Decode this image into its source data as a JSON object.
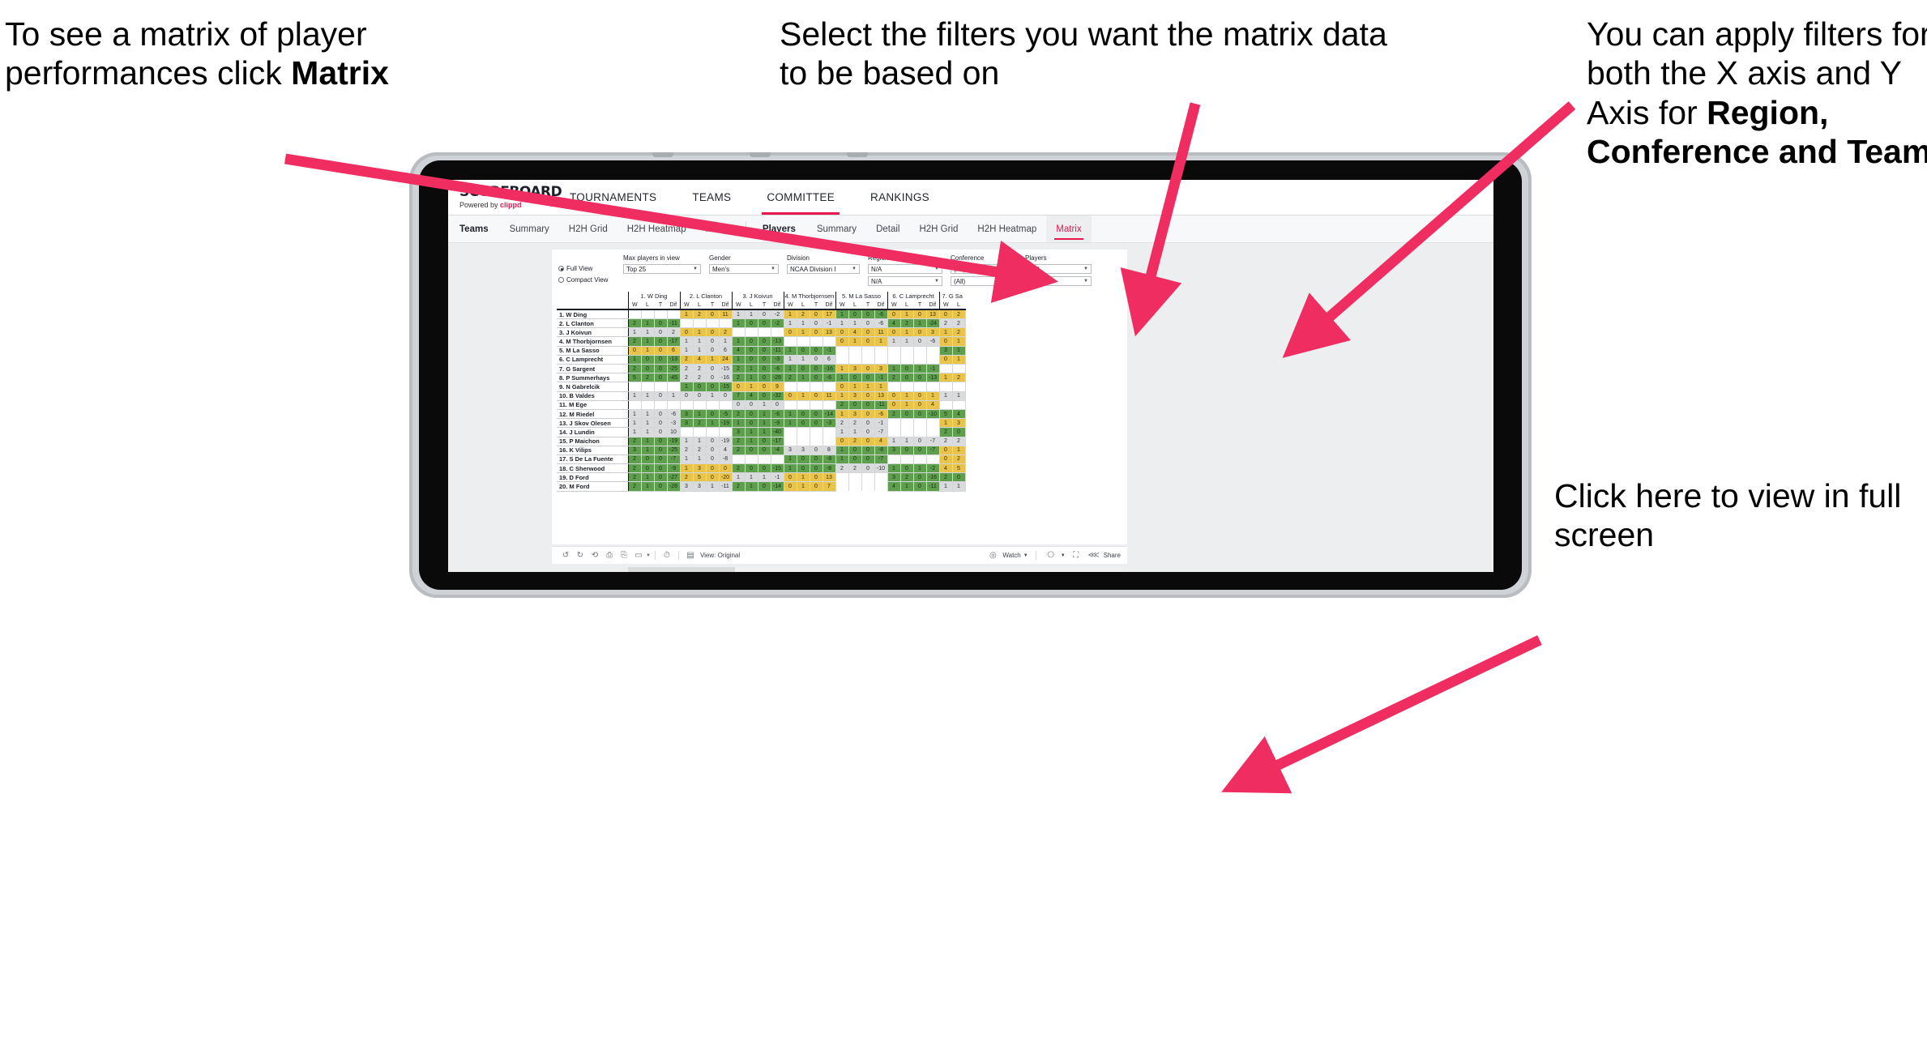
{
  "annotations": {
    "left": {
      "text_before": "To see a matrix of player performances click ",
      "bold": "Matrix"
    },
    "middle": {
      "text": "Select the filters you want the matrix data to be based on"
    },
    "right": {
      "text_before": "You  can apply filters for both the X axis and Y Axis for ",
      "bold": "Region, Conference and Team"
    },
    "fullscreen": {
      "text": "Click here to view in full screen"
    }
  },
  "brand": {
    "name": "SCOREBOARD",
    "powered_prefix": "Powered by ",
    "powered_brand": "clippd",
    "accent": "#e8174e"
  },
  "topnav": {
    "items": [
      "TOURNAMENTS",
      "TEAMS",
      "COMMITTEE",
      "RANKINGS"
    ],
    "active": "TEAMS"
  },
  "subnav": {
    "teams_group": {
      "title": "Teams",
      "items": [
        "Summary",
        "H2H Grid",
        "H2H Heatmap",
        "Matrix"
      ]
    },
    "players_group": {
      "title": "Players",
      "items": [
        "Summary",
        "Detail",
        "H2H Grid",
        "H2H Heatmap",
        "Matrix"
      ],
      "active": "Matrix"
    }
  },
  "filters": {
    "view_modes": [
      "Full View",
      "Compact View"
    ],
    "view_selected": "Full View",
    "fields": [
      {
        "label": "Max players in view",
        "value": "Top 25"
      },
      {
        "label": "Gender",
        "value": "Men's"
      },
      {
        "label": "Division",
        "value": "NCAA Division I"
      },
      {
        "label": "Region",
        "value": "N/A",
        "value2": "N/A"
      },
      {
        "label": "Conference",
        "value": "(All)",
        "value2": "(All)"
      },
      {
        "label": "Players",
        "value": "(All)",
        "value2": "(All)"
      }
    ]
  },
  "matrix": {
    "sub_headers": [
      "W",
      "L",
      "T",
      "Dif"
    ],
    "columns": [
      "1. W Ding",
      "2. L Clanton",
      "3. J Koivun",
      "4. M Thorbjornsen",
      "5. M La Sasso",
      "6. C Lamprecht",
      "7. G Sa"
    ],
    "rows": [
      "1. W Ding",
      "2. L Clanton",
      "3. J Koivun",
      "4. M Thorbjornsen",
      "5. M La Sasso",
      "6. C Lamprecht",
      "7. G Sargent",
      "8. P Summerhays",
      "9. N Gabrelcik",
      "10. B Valdes",
      "11. M Ege",
      "12. M Riedel",
      "13. J Skov Olesen",
      "14. J Lundin",
      "15. P Maichon",
      "16. K Vilips",
      "17. S De La Fuente",
      "18. C Sherwood",
      "19. D Ford",
      "20. M Ford"
    ],
    "legend_colors": {
      "win": "#5f9e4e",
      "tie": "#e8c44a",
      "loss": "#d9dbdd",
      "empty": "#ffffff"
    },
    "cells": [
      [
        null,
        [
          "1",
          "2",
          "0",
          "11",
          "y"
        ],
        [
          "1",
          "1",
          "0",
          "-2",
          "n"
        ],
        [
          "1",
          "2",
          "0",
          "17",
          "y"
        ],
        [
          "1",
          "0",
          "0",
          "-6",
          "g"
        ],
        [
          "0",
          "1",
          "0",
          "13",
          "y"
        ],
        [
          "0",
          "2",
          "g2y"
        ]
      ],
      [
        [
          "2",
          "1",
          "0",
          "-11",
          "g"
        ],
        null,
        [
          "1",
          "0",
          "0",
          "-2",
          "g"
        ],
        [
          "1",
          "1",
          "0",
          "-1",
          "n"
        ],
        [
          "1",
          "1",
          "0",
          "-6",
          "n"
        ],
        [
          "4",
          "2",
          "1",
          "-24",
          "g"
        ],
        [
          "2",
          "2",
          "n"
        ]
      ],
      [
        [
          "1",
          "1",
          "0",
          "2",
          "n"
        ],
        [
          "0",
          "1",
          "0",
          "2",
          "y"
        ],
        null,
        [
          "0",
          "1",
          "0",
          "13",
          "y"
        ],
        [
          "0",
          "4",
          "0",
          "11",
          "y"
        ],
        [
          "0",
          "1",
          "0",
          "3",
          "y"
        ],
        [
          "1",
          "2",
          "y"
        ]
      ],
      [
        [
          "2",
          "1",
          "0",
          "-17",
          "g"
        ],
        [
          "1",
          "1",
          "0",
          "1",
          "n"
        ],
        [
          "1",
          "0",
          "0",
          "-13",
          "g"
        ],
        null,
        [
          "0",
          "1",
          "0",
          "1",
          "y"
        ],
        [
          "1",
          "1",
          "0",
          "-6",
          "n"
        ],
        [
          "0",
          "1",
          "y"
        ]
      ],
      [
        [
          "0",
          "1",
          "0",
          "6",
          "y"
        ],
        [
          "1",
          "1",
          "0",
          "6",
          "n"
        ],
        [
          "4",
          "0",
          "0",
          "-11",
          "g"
        ],
        [
          "1",
          "0",
          "0",
          "-1",
          "g"
        ],
        null,
        null,
        [
          "3",
          "1",
          "g"
        ]
      ],
      [
        [
          "1",
          "0",
          "0",
          "-13",
          "g"
        ],
        [
          "2",
          "4",
          "1",
          "24",
          "y"
        ],
        [
          "1",
          "0",
          "0",
          "-3",
          "g"
        ],
        [
          "1",
          "1",
          "0",
          "6",
          "n"
        ],
        null,
        null,
        [
          "0",
          "1",
          "y"
        ]
      ],
      [
        [
          "2",
          "0",
          "0",
          "-25",
          "g"
        ],
        [
          "2",
          "2",
          "0",
          "-15",
          "n"
        ],
        [
          "2",
          "1",
          "0",
          "-6",
          "g"
        ],
        [
          "1",
          "0",
          "0",
          "-16",
          "g"
        ],
        [
          "1",
          "3",
          "0",
          "3",
          "y"
        ],
        [
          "1",
          "0",
          "1",
          "-1",
          "g"
        ],
        null
      ],
      [
        [
          "5",
          "2",
          "0",
          "-45",
          "g"
        ],
        [
          "2",
          "2",
          "0",
          "-16",
          "n"
        ],
        [
          "2",
          "1",
          "0",
          "-28",
          "g"
        ],
        [
          "2",
          "1",
          "0",
          "-6",
          "g"
        ],
        [
          "1",
          "0",
          "0",
          "-1",
          "g"
        ],
        [
          "2",
          "0",
          "0",
          "-13",
          "g"
        ],
        [
          "1",
          "2",
          "y"
        ]
      ],
      [
        null,
        [
          "1",
          "0",
          "0",
          "-15",
          "g"
        ],
        [
          "0",
          "1",
          "0",
          "9",
          "y"
        ],
        null,
        [
          "0",
          "1",
          "1",
          "1",
          "y"
        ],
        null,
        null
      ],
      [
        [
          "1",
          "1",
          "0",
          "1",
          "n"
        ],
        [
          "0",
          "0",
          "1",
          "0",
          "n"
        ],
        [
          "7",
          "4",
          "0",
          "-32",
          "g"
        ],
        [
          "0",
          "1",
          "0",
          "11",
          "y"
        ],
        [
          "1",
          "3",
          "0",
          "13",
          "y"
        ],
        [
          "0",
          "1",
          "0",
          "1",
          "y"
        ],
        [
          "1",
          "1",
          "n"
        ]
      ],
      [
        null,
        null,
        [
          "0",
          "0",
          "1",
          "0",
          "n"
        ],
        null,
        [
          "2",
          "0",
          "0",
          "-11",
          "g"
        ],
        [
          "0",
          "1",
          "0",
          "4",
          "y"
        ],
        null
      ],
      [
        [
          "1",
          "1",
          "0",
          "-6",
          "n"
        ],
        [
          "3",
          "1",
          "0",
          "-5",
          "g"
        ],
        [
          "2",
          "0",
          "1",
          "-6",
          "g"
        ],
        [
          "1",
          "0",
          "0",
          "-14",
          "g"
        ],
        [
          "1",
          "3",
          "0",
          "-6",
          "y"
        ],
        [
          "2",
          "0",
          "0",
          "-10",
          "g"
        ],
        [
          "5",
          "4",
          "g"
        ]
      ],
      [
        [
          "1",
          "1",
          "0",
          "-3",
          "n"
        ],
        [
          "3",
          "2",
          "1",
          "-19",
          "g"
        ],
        [
          "1",
          "0",
          "1",
          "-9",
          "g"
        ],
        [
          "1",
          "0",
          "0",
          "-3",
          "g"
        ],
        [
          "2",
          "2",
          "0",
          "-1",
          "n"
        ],
        null,
        [
          "1",
          "3",
          "y"
        ]
      ],
      [
        [
          "1",
          "1",
          "0",
          "10",
          "n"
        ],
        null,
        [
          "3",
          "1",
          "1",
          "-40",
          "g"
        ],
        null,
        [
          "1",
          "1",
          "0",
          "-7",
          "n"
        ],
        null,
        [
          "2",
          "0",
          "g"
        ]
      ],
      [
        [
          "2",
          "1",
          "0",
          "-19",
          "g"
        ],
        [
          "1",
          "1",
          "0",
          "-19",
          "n"
        ],
        [
          "2",
          "1",
          "0",
          "-17",
          "g"
        ],
        null,
        [
          "0",
          "2",
          "0",
          "4",
          "y"
        ],
        [
          "1",
          "1",
          "0",
          "-7",
          "n"
        ],
        [
          "2",
          "2",
          "n"
        ]
      ],
      [
        [
          "3",
          "1",
          "0",
          "-25",
          "g"
        ],
        [
          "2",
          "2",
          "0",
          "4",
          "n"
        ],
        [
          "2",
          "0",
          "0",
          "-4",
          "g"
        ],
        [
          "3",
          "3",
          "0",
          "8",
          "n"
        ],
        [
          "1",
          "0",
          "0",
          "-8",
          "g"
        ],
        [
          "3",
          "0",
          "0",
          "-7",
          "g"
        ],
        [
          "0",
          "1",
          "y"
        ]
      ],
      [
        [
          "2",
          "0",
          "0",
          "-7",
          "g"
        ],
        [
          "1",
          "1",
          "0",
          "-8",
          "n"
        ],
        null,
        [
          "1",
          "0",
          "0",
          "-8",
          "g"
        ],
        [
          "1",
          "0",
          "0",
          "-7",
          "g"
        ],
        null,
        [
          "0",
          "2",
          "y"
        ]
      ],
      [
        [
          "2",
          "0",
          "0",
          "-9",
          "g"
        ],
        [
          "1",
          "3",
          "0",
          "0",
          "y"
        ],
        [
          "2",
          "0",
          "0",
          "-15",
          "g"
        ],
        [
          "1",
          "0",
          "0",
          "-8",
          "g"
        ],
        [
          "2",
          "2",
          "0",
          "-10",
          "n"
        ],
        [
          "1",
          "0",
          "1",
          "-2",
          "g"
        ],
        [
          "4",
          "5",
          "y"
        ]
      ],
      [
        [
          "2",
          "1",
          "0",
          "-27",
          "g"
        ],
        [
          "2",
          "5",
          "0",
          "-20",
          "y"
        ],
        [
          "1",
          "1",
          "1",
          "-1",
          "n"
        ],
        [
          "0",
          "1",
          "0",
          "13",
          "y"
        ],
        null,
        [
          "3",
          "2",
          "0",
          "-16",
          "g"
        ],
        [
          "2",
          "0",
          "g"
        ]
      ],
      [
        [
          "2",
          "1",
          "0",
          "-28",
          "g"
        ],
        [
          "3",
          "3",
          "1",
          "-11",
          "n"
        ],
        [
          "2",
          "1",
          "0",
          "-14",
          "g"
        ],
        [
          "0",
          "1",
          "0",
          "7",
          "y"
        ],
        null,
        [
          "4",
          "1",
          "0",
          "-11",
          "g"
        ],
        [
          "1",
          "1",
          "n"
        ]
      ]
    ]
  },
  "toolbar": {
    "icons": [
      "undo-icon",
      "redo-icon",
      "revert-icon",
      "pause-icon",
      "refresh-icon",
      "device-icon"
    ],
    "alert_icon": "alert-icon",
    "view_label": "View: Original",
    "watch_label": "Watch",
    "present_icon": "present-icon",
    "fullscreen_icon": "fullscreen-icon",
    "share_label": "Share"
  }
}
